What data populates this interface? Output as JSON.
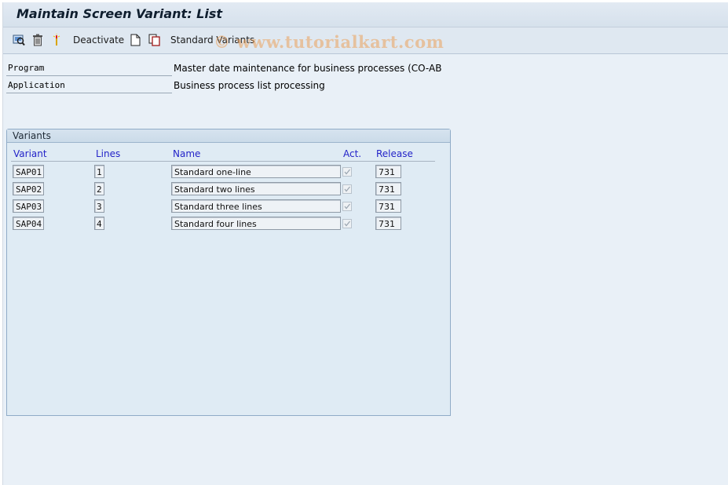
{
  "window": {
    "title": "Maintain Screen Variant: List"
  },
  "toolbar": {
    "items": [
      {
        "icon": "display-icon",
        "label": ""
      },
      {
        "icon": "delete-icon",
        "label": ""
      },
      {
        "icon": "activate-icon",
        "label": ""
      },
      {
        "icon": "",
        "label": "Deactivate"
      },
      {
        "icon": "create-icon",
        "label": ""
      },
      {
        "icon": "copy-icon",
        "label": ""
      },
      {
        "icon": "",
        "label": "Standard Variants"
      }
    ],
    "deactivate_label": "Deactivate",
    "standard_variants_label": "Standard Variants"
  },
  "watermark": "© www.tutorialkart.com",
  "header": {
    "program_label": "Program",
    "program_value": "Master date maintenance for business processes (CO-AB",
    "application_label": "Application",
    "application_value": "Business process list processing"
  },
  "variants": {
    "group_title": "Variants",
    "columns": {
      "variant": "Variant",
      "lines": "Lines",
      "name": "Name",
      "act": "Act.",
      "release": "Release"
    },
    "rows": [
      {
        "variant": "SAP01",
        "lines": "1",
        "name": "Standard one-line",
        "active": true,
        "release": "731"
      },
      {
        "variant": "SAP02",
        "lines": "2",
        "name": "Standard two lines",
        "active": true,
        "release": "731"
      },
      {
        "variant": "SAP03",
        "lines": "3",
        "name": "Standard three lines",
        "active": true,
        "release": "731"
      },
      {
        "variant": "SAP04",
        "lines": "4",
        "name": "Standard four lines",
        "active": true,
        "release": "731"
      }
    ]
  }
}
